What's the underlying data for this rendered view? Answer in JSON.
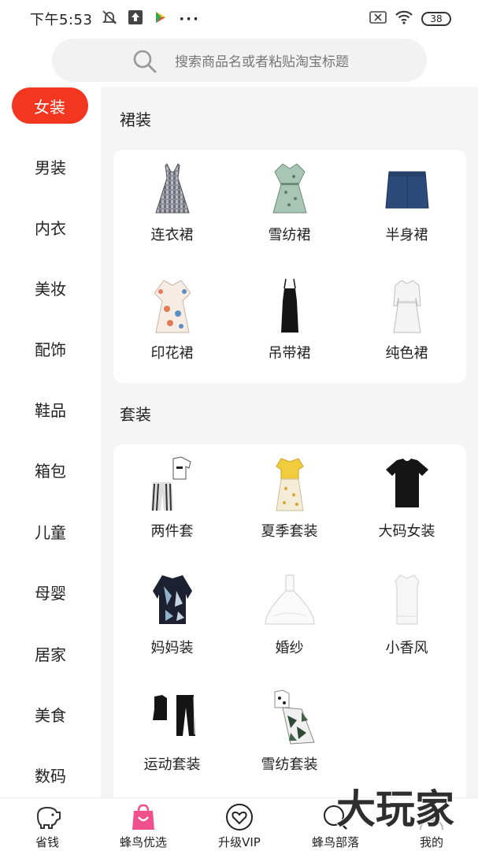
{
  "status": {
    "time": "下午5:53",
    "battery": "38"
  },
  "search": {
    "placeholder": "搜索商品名或者粘贴淘宝标题"
  },
  "sidebar": {
    "items": [
      {
        "label": "女装",
        "active": true
      },
      {
        "label": "男装"
      },
      {
        "label": "内衣"
      },
      {
        "label": "美妆"
      },
      {
        "label": "配饰"
      },
      {
        "label": "鞋品"
      },
      {
        "label": "箱包"
      },
      {
        "label": "儿童"
      },
      {
        "label": "母婴"
      },
      {
        "label": "居家"
      },
      {
        "label": "美食"
      },
      {
        "label": "数码"
      }
    ]
  },
  "sections": [
    {
      "title": "裙装",
      "items": [
        {
          "label": "连衣裙",
          "icon": "plaid-dress-icon"
        },
        {
          "label": "雪纺裙",
          "icon": "chiffon-dress-icon"
        },
        {
          "label": "半身裙",
          "icon": "denim-skirt-icon"
        },
        {
          "label": "印花裙",
          "icon": "print-dress-icon"
        },
        {
          "label": "吊带裙",
          "icon": "slip-dress-icon"
        },
        {
          "label": "纯色裙",
          "icon": "solid-dress-icon"
        }
      ]
    },
    {
      "title": "套装",
      "items": [
        {
          "label": "两件套",
          "icon": "two-piece-icon"
        },
        {
          "label": "夏季套装",
          "icon": "summer-set-icon"
        },
        {
          "label": "大码女装",
          "icon": "plus-size-tee-icon"
        },
        {
          "label": "妈妈装",
          "icon": "mom-wear-icon"
        },
        {
          "label": "婚纱",
          "icon": "wedding-dress-icon"
        },
        {
          "label": "小香风",
          "icon": "chanel-style-icon"
        },
        {
          "label": "运动套装",
          "icon": "sport-set-icon"
        },
        {
          "label": "雪纺套装",
          "icon": "chiffon-set-icon"
        }
      ]
    }
  ],
  "bottom_nav": {
    "items": [
      {
        "label": "省钱",
        "icon": "piggy-bank-icon"
      },
      {
        "label": "蜂鸟优选",
        "icon": "shop-bag-icon"
      },
      {
        "label": "升级VIP",
        "icon": "vip-heart-icon"
      },
      {
        "label": "蜂鸟部落",
        "icon": "tribe-icon"
      },
      {
        "label": "我的",
        "icon": "profile-icon"
      }
    ]
  },
  "watermark": {
    "text": "大玩家"
  },
  "colors": {
    "accent": "#f2361f",
    "panel_bg": "#f5f5f5",
    "nav_pink": "#f0508c"
  }
}
